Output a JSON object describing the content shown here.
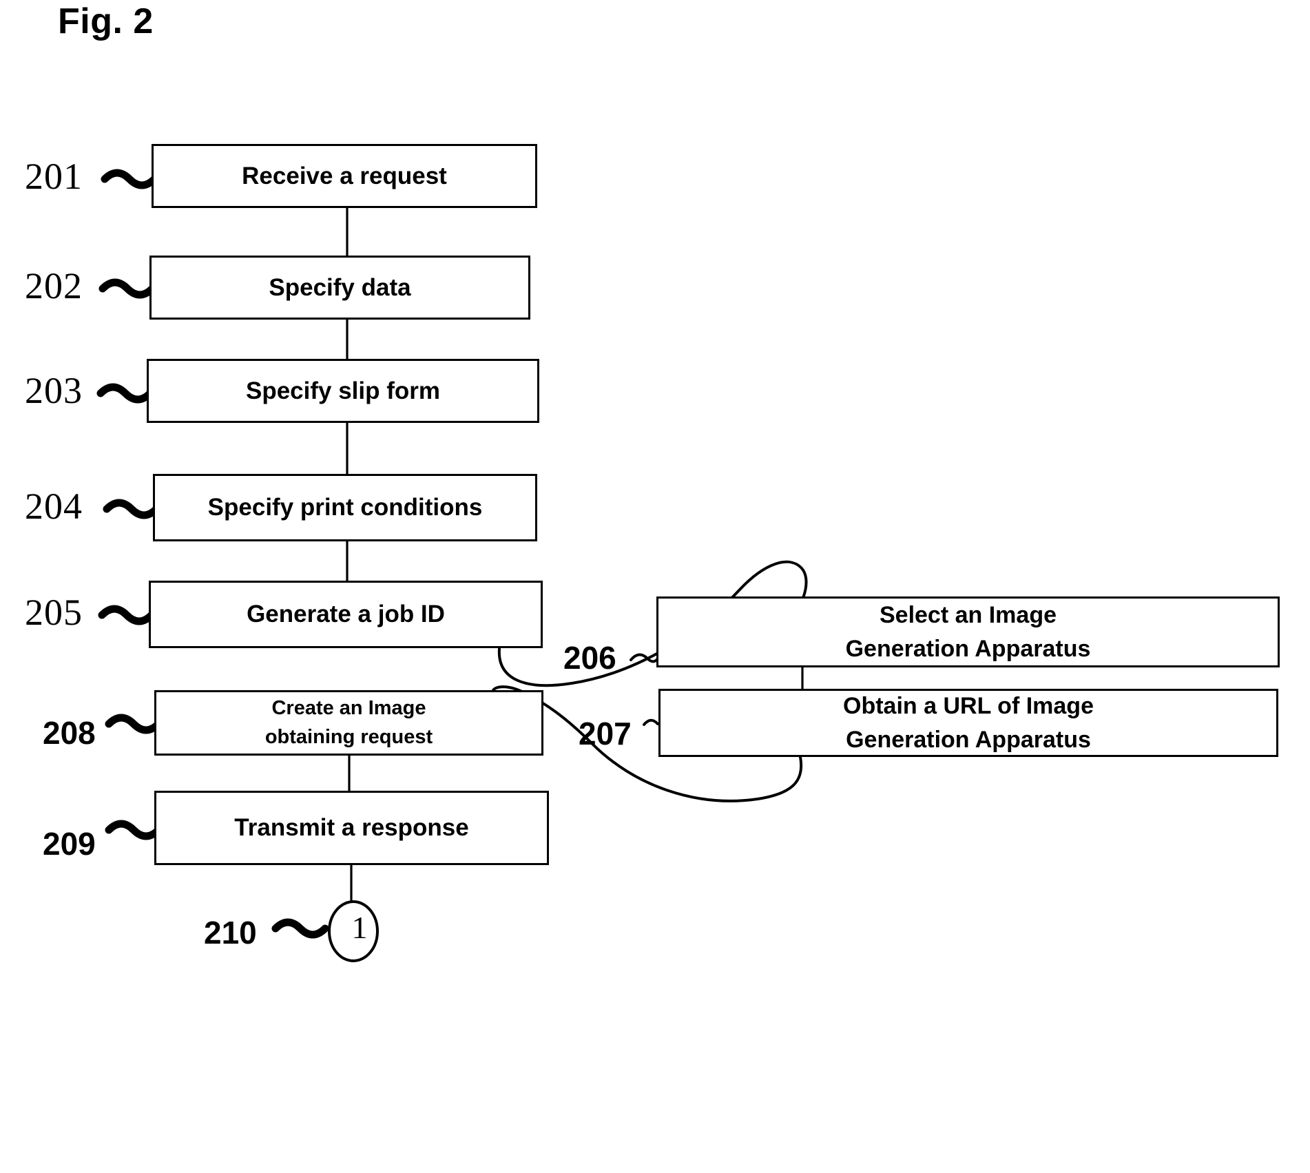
{
  "figure": {
    "title": "Fig. 2",
    "type": "flowchart"
  },
  "steps": [
    {
      "ref": "201",
      "label_line1": "Receive a request",
      "label_line2": ""
    },
    {
      "ref": "202",
      "label_line1": "Specify data",
      "label_line2": ""
    },
    {
      "ref": "203",
      "label_line1": "Specify slip form",
      "label_line2": ""
    },
    {
      "ref": "204",
      "label_line1": "Specify print conditions",
      "label_line2": ""
    },
    {
      "ref": "205",
      "label_line1": "Generate a job ID",
      "label_line2": ""
    },
    {
      "ref": "206",
      "label_line1": "Select an Image",
      "label_line2": "Generation Apparatus"
    },
    {
      "ref": "207",
      "label_line1": "Obtain a URL of Image",
      "label_line2": "Generation Apparatus"
    },
    {
      "ref": "208",
      "label_line1": "Create an Image",
      "label_line2": "obtaining request"
    },
    {
      "ref": "209",
      "label_line1": "Transmit a response",
      "label_line2": ""
    },
    {
      "ref": "210",
      "label_line1": "1",
      "label_line2": ""
    }
  ],
  "connector_symbol": {
    "ref": "210",
    "glyph": "1",
    "shape": "circle"
  },
  "colors": {
    "stroke": "#000000",
    "fill": "#ffffff",
    "text": "#000000"
  }
}
